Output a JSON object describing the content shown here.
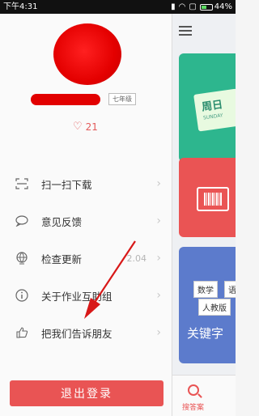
{
  "status_bar": {
    "time": "下午4:31",
    "battery": "44%"
  },
  "profile": {
    "grade": "七年级",
    "likes": "21"
  },
  "menu": {
    "items": [
      {
        "label": "扫一扫下载",
        "icon": "scan-icon"
      },
      {
        "label": "意见反馈",
        "icon": "chat-bubble-icon"
      },
      {
        "label": "检查更新",
        "icon": "globe-icon",
        "meta": "2.04"
      },
      {
        "label": "关于作业互助组",
        "icon": "info-icon"
      },
      {
        "label": "把我们告诉朋友",
        "icon": "thumbs-up-icon"
      }
    ]
  },
  "logout": {
    "label": "退出登录"
  },
  "peek": {
    "sticky_title": "周日",
    "sticky_sub": "SUNDAY",
    "tags": [
      "数学",
      "语",
      "人教版"
    ],
    "card_title": "关键字",
    "tab_label": "搜答案"
  },
  "colors": {
    "accent": "#e95454",
    "green_card": "#2db68e",
    "blue_card": "#5c7bcc"
  }
}
